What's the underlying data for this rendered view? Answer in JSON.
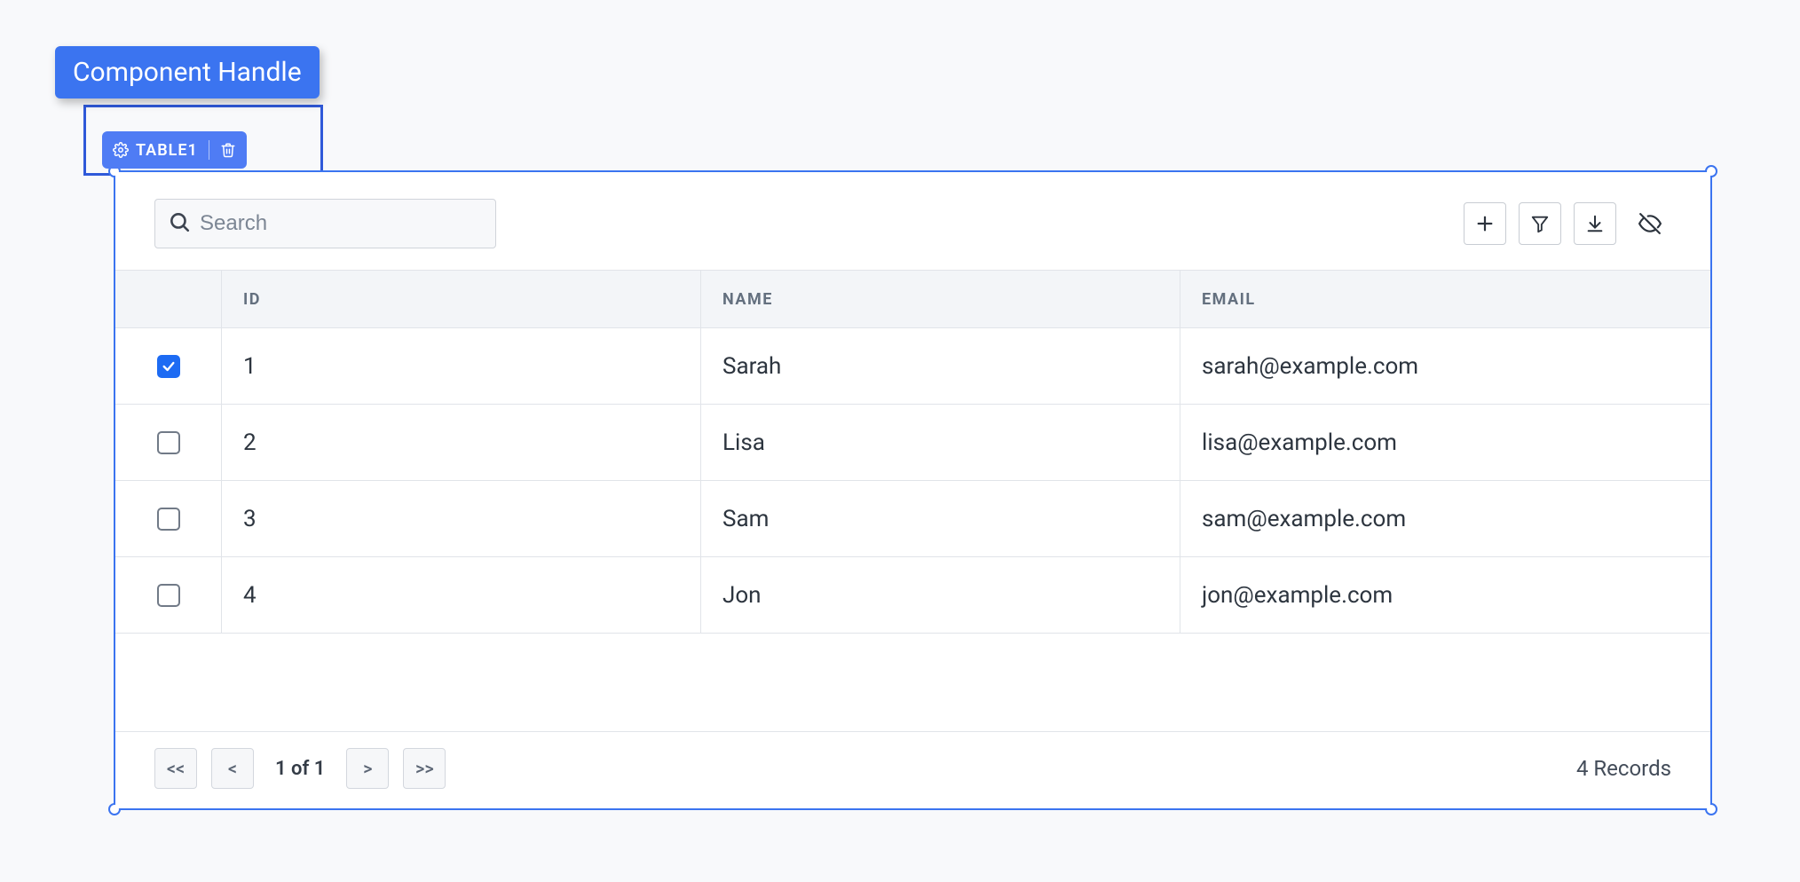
{
  "callout": {
    "label": "Component Handle"
  },
  "handle": {
    "component_name": "TABLE1",
    "gear_icon": "gear-icon",
    "delete_icon": "trash-icon"
  },
  "search": {
    "placeholder": "Search",
    "value": ""
  },
  "toolbar": {
    "add_icon": "plus-icon",
    "filter_icon": "filter-icon",
    "download_icon": "download-icon",
    "hide_icon": "eye-off-icon"
  },
  "columns": {
    "id": "ID",
    "name": "NAME",
    "email": "EMAIL"
  },
  "rows": [
    {
      "checked": true,
      "id": "1",
      "name": "Sarah",
      "email": "sarah@example.com"
    },
    {
      "checked": false,
      "id": "2",
      "name": "Lisa",
      "email": "lisa@example.com"
    },
    {
      "checked": false,
      "id": "3",
      "name": "Sam",
      "email": "sam@example.com"
    },
    {
      "checked": false,
      "id": "4",
      "name": "Jon",
      "email": "jon@example.com"
    }
  ],
  "pagination": {
    "first": "<<",
    "prev": "<",
    "status": "1 of 1",
    "next": ">",
    "last": ">>"
  },
  "record_count": "4 Records",
  "colors": {
    "primary": "#3b74f0"
  }
}
